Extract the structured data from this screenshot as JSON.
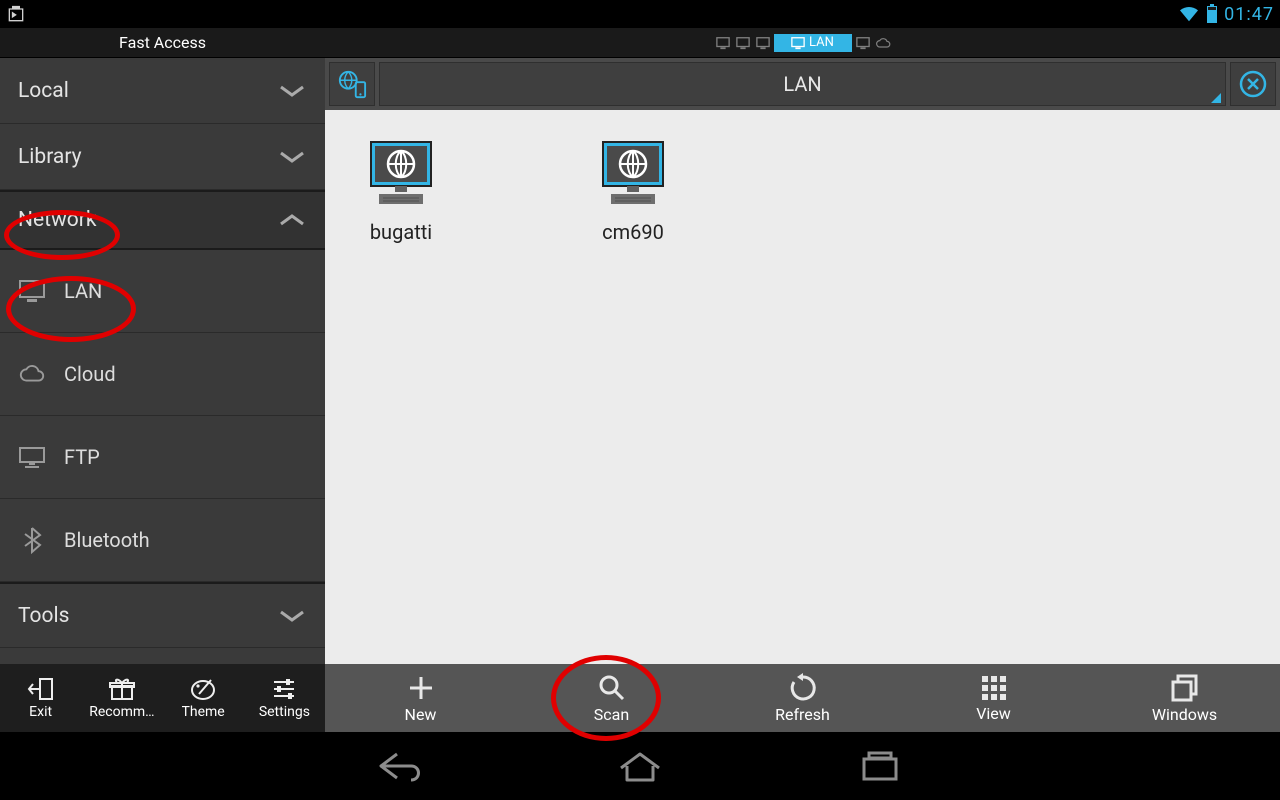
{
  "status": {
    "time": "01:47"
  },
  "header": {
    "fast_access": "Fast Access",
    "active_tab_label": "LAN"
  },
  "sidebar": {
    "local": "Local",
    "library": "Library",
    "network": "Network",
    "tools": "Tools",
    "sub": {
      "lan": "LAN",
      "cloud": "Cloud",
      "ftp": "FTP",
      "bluetooth": "Bluetooth"
    },
    "toolbar": {
      "exit": "Exit",
      "recommend": "Recomm…",
      "theme": "Theme",
      "settings": "Settings"
    }
  },
  "path": {
    "title": "LAN"
  },
  "hosts": [
    {
      "name": "bugatti"
    },
    {
      "name": "cm690"
    }
  ],
  "content_toolbar": {
    "new": "New",
    "scan": "Scan",
    "refresh": "Refresh",
    "view": "View",
    "windows": "Windows"
  }
}
